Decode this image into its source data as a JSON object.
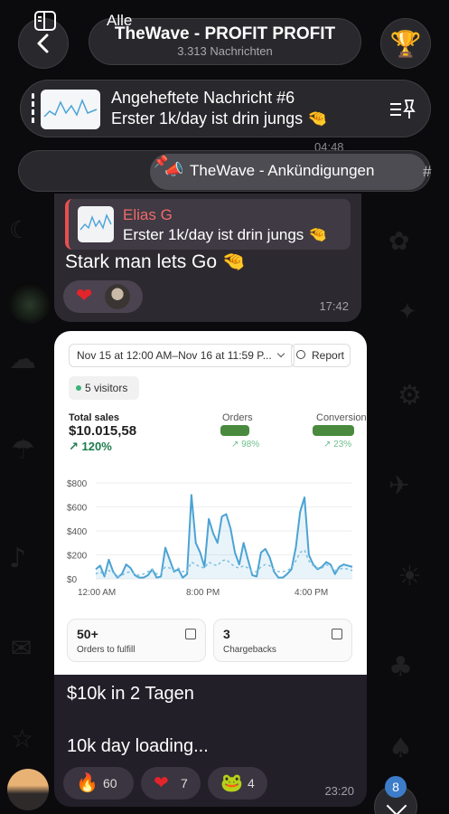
{
  "header": {
    "back_icon": "chevron-left-icon",
    "title": "TheWave - PROFIT PROFIT",
    "subtitle": "3.313 Nachrichten",
    "trophy_icon": "trophy-icon"
  },
  "pinned": {
    "title": "Angeheftete Nachricht #6",
    "message": "Erster 1k/day ist drin jungs 🤏",
    "list_icon": "pinned-list-icon"
  },
  "filters": {
    "all_label": "Alle",
    "active_label": "TheWave - Ankündigungen",
    "more_label": "#"
  },
  "prev_message": {
    "time": "04:48"
  },
  "message1": {
    "reply_name": "Elias G",
    "reply_text": "Erster 1k/day ist drin jungs 🤏",
    "text": "Stark man lets Go 🤏",
    "reaction": "❤",
    "time": "17:42"
  },
  "shopify": {
    "date_range": "Nov 15 at 12:00 AM–Nov 16 at 11:59 P...",
    "report_label": "Report",
    "visitors": "5 visitors",
    "total_sales_label": "Total sales",
    "total_sales": "$10.015,58",
    "total_sales_change": "↗ 120%",
    "orders_label": "Orders",
    "orders_change": "↗ 98%",
    "conversion_label": "Conversion",
    "conversion_change": "↗ 23%",
    "card1_value": "50+",
    "card1_label": "Orders to fulfill",
    "card2_value": "3",
    "card2_label": "Chargebacks"
  },
  "chart_data": {
    "type": "line",
    "ylim": [
      0,
      800
    ],
    "yticks": [
      "$800",
      "$600",
      "$400",
      "$200",
      "$0"
    ],
    "xticks": [
      "12:00 AM",
      "8:00 PM",
      "4:00 PM"
    ],
    "series": [
      {
        "values": [
          80,
          110,
          20,
          160,
          60,
          10,
          40,
          120,
          90,
          30,
          10,
          10,
          30,
          80,
          10,
          20,
          260,
          160,
          60,
          80,
          10,
          40,
          700,
          300,
          220,
          100,
          500,
          380,
          300,
          520,
          540,
          420,
          220,
          120,
          300,
          160,
          30,
          20,
          220,
          250,
          180,
          60,
          10,
          10,
          40,
          80,
          260,
          560,
          680,
          200,
          120,
          80,
          100,
          140,
          120,
          40,
          100,
          120,
          110,
          100
        ]
      },
      {
        "values": [
          40,
          60,
          30,
          70,
          50,
          20,
          30,
          50,
          60,
          40,
          30,
          40,
          60,
          80,
          40,
          50,
          100,
          90,
          70,
          90,
          60,
          60,
          140,
          120,
          100,
          90,
          140,
          120,
          110,
          150,
          160,
          130,
          100,
          90,
          110,
          90,
          60,
          60,
          100,
          120,
          110,
          80,
          60,
          60,
          70,
          90,
          150,
          220,
          240,
          150,
          110,
          90,
          90,
          120,
          100,
          70,
          80,
          90,
          80,
          70
        ]
      }
    ]
  },
  "message2": {
    "text1": "$10k in 2 Tagen",
    "text2": "10k day loading...",
    "reactions": [
      {
        "emoji": "🔥",
        "count": "60"
      },
      {
        "emoji": "❤",
        "count": "7"
      },
      {
        "emoji": "🐸",
        "count": "4"
      }
    ],
    "time": "23:20"
  },
  "scroll": {
    "unread_count": "8"
  }
}
